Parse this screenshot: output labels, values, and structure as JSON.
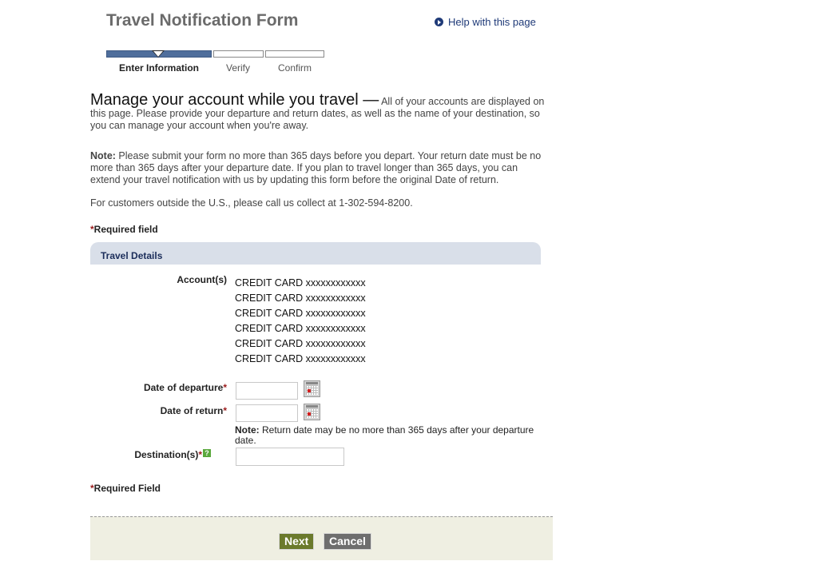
{
  "header": {
    "title": "Travel Notification Form",
    "help_link": "Help with this page"
  },
  "progress": {
    "steps": [
      {
        "label": "Enter Information",
        "active": true
      },
      {
        "label": "Verify",
        "active": false
      },
      {
        "label": "Confirm",
        "active": false
      }
    ],
    "current_step": 1
  },
  "intro": {
    "heading": "Manage your account while you travel —",
    "text": " All of your accounts are displayed on this page. Please provide your departure and return dates, as well as the name of your destination, so you can manage your account when you're away."
  },
  "note": {
    "label": "Note:",
    "text": " Please submit your form no more than 365 days before you depart. Your return date must be no more than 365 days after your departure date. If you plan to travel longer than 365 days, you can extend your travel notification with us by updating this form before the original Date of return."
  },
  "international": "For customers outside the U.S., please call us collect at 1-302-594-8200.",
  "required": {
    "star": "*",
    "top_label": "Required field",
    "bottom_label": "Required Field"
  },
  "section": {
    "title": "Travel Details"
  },
  "form": {
    "accounts_label": "Account(s)",
    "accounts": [
      "CREDIT CARD xxxxxxxxxxxx",
      "CREDIT CARD xxxxxxxxxxxx",
      "CREDIT CARD xxxxxxxxxxxx",
      "CREDIT CARD xxxxxxxxxxxx",
      "CREDIT CARD xxxxxxxxxxxx",
      "CREDIT CARD xxxxxxxxxxxx"
    ],
    "departure_label": "Date of departure",
    "departure_value": "",
    "return_label": "Date of return",
    "return_value": "",
    "return_note_label": "Note:",
    "return_note_text": " Return date may be no more than 365 days after your departure date.",
    "destination_label": "Destination(s)",
    "destination_value": "",
    "help_glyph": "?"
  },
  "buttons": {
    "next": "Next",
    "cancel": "Cancel"
  },
  "colors": {
    "progress_active": "#4f6e9c",
    "section_header_bg": "#d9dfe9",
    "required_star": "#9b1b1b",
    "next_button": "#6b7a2c",
    "cancel_button": "#6e6e6e",
    "footer_bg": "#efefe2",
    "link": "#1f3a78"
  }
}
